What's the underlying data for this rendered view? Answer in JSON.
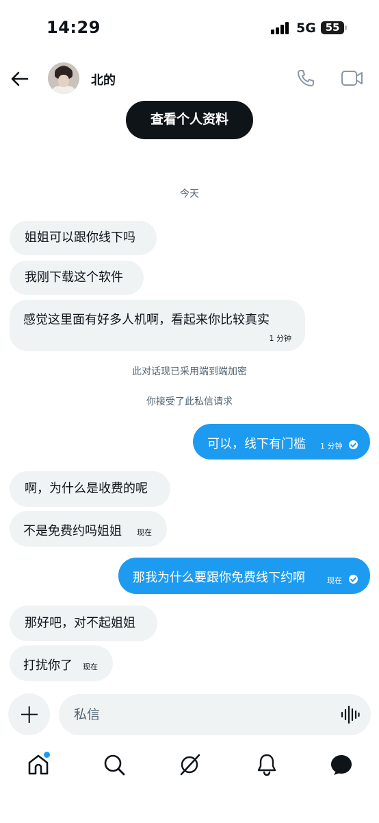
{
  "status_bar": {
    "time": "14:29",
    "network": "5G",
    "battery": "55"
  },
  "header": {
    "name": "北的",
    "profile_button": "查看个人资料"
  },
  "system": {
    "date_divider": "今天",
    "encryption_notice": "此对话现已采用端到端加密",
    "request_notice": "你接受了此私信请求"
  },
  "messages": [
    {
      "direction": "in",
      "text": "姐姐可以跟你线下吗",
      "time": ""
    },
    {
      "direction": "in",
      "text": "我刚下载这个软件",
      "time": ""
    },
    {
      "direction": "in",
      "text": "感觉这里面有好多人机啊，看起来你比较真实",
      "time": "1 分钟"
    },
    {
      "direction": "out",
      "text": "可以，线下有门槛",
      "time": "1 分钟"
    },
    {
      "direction": "in",
      "text": "啊，为什么是收费的呢",
      "time": ""
    },
    {
      "direction": "in",
      "text": "不是免费约吗姐姐",
      "time": "现在"
    },
    {
      "direction": "out",
      "text": "那我为什么要跟你免费线下约啊",
      "time": "现在"
    },
    {
      "direction": "in",
      "text": "那好吧，对不起姐姐",
      "time": ""
    },
    {
      "direction": "in",
      "text": "打扰你了",
      "time": "现在"
    }
  ],
  "composer": {
    "placeholder": "私信"
  },
  "nav": {
    "items": [
      "home-icon",
      "search-icon",
      "grok-icon",
      "notifications-icon",
      "messages-icon"
    ],
    "home_has_badge": true
  },
  "colors": {
    "accent": "#1d9bf0",
    "incoming_bubble": "#eff3f4",
    "text": "#0f1419",
    "muted": "#536471"
  }
}
